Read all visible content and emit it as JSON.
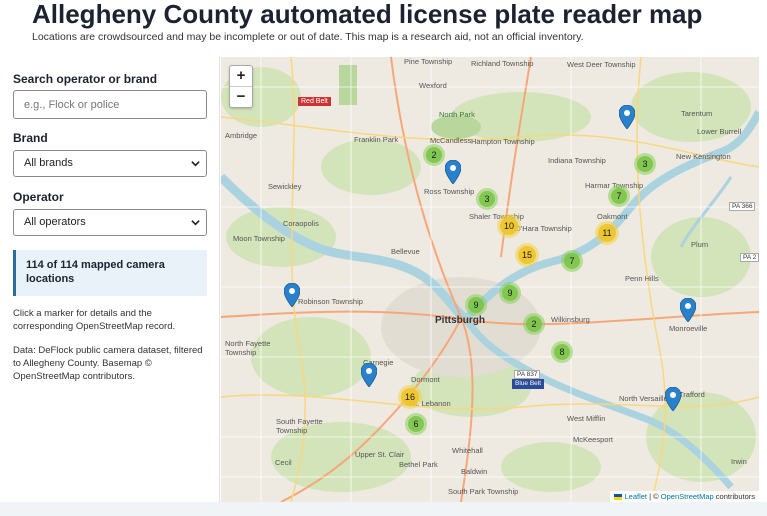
{
  "header": {
    "title": "Allegheny County automated license plate reader map",
    "subtitle": "Locations are crowdsourced and may be incomplete or out of date. This map is a research aid, not an official inventory."
  },
  "sidebar": {
    "search_label": "Search operator or brand",
    "search_placeholder": "e.g., Flock or police",
    "search_value": "",
    "brand_label": "Brand",
    "brand_selected": "All brands",
    "operator_label": "Operator",
    "operator_selected": "All operators",
    "count_text": "114 of 114 mapped camera locations",
    "help_text": "Click a marker for details and the corresponding OpenStreetMap record.",
    "source_text": "Data: DeFlock public camera dataset, filtered to Allegheny County. Basemap © OpenStreetMap contributors."
  },
  "map": {
    "zoom_in": "+",
    "zoom_out": "−",
    "attribution_leaflet": "Leaflet",
    "attribution_sep": " | © ",
    "attribution_osm": "OpenStreetMap",
    "attribution_tail": " contributors",
    "colors": {
      "small_cluster": "#78c346",
      "medium_cluster": "#eec428",
      "pin": "#2a81cb",
      "river": "#aad3df"
    },
    "clusters": [
      {
        "count": "2",
        "size": "small"
      },
      {
        "count": "3",
        "size": "small"
      },
      {
        "count": "3",
        "size": "small"
      },
      {
        "count": "7",
        "size": "small"
      },
      {
        "count": "10",
        "size": "medium"
      },
      {
        "count": "11",
        "size": "medium"
      },
      {
        "count": "15",
        "size": "medium"
      },
      {
        "count": "7",
        "size": "small"
      },
      {
        "count": "9",
        "size": "small"
      },
      {
        "count": "9",
        "size": "small"
      },
      {
        "count": "2",
        "size": "small"
      },
      {
        "count": "8",
        "size": "small"
      },
      {
        "count": "16",
        "size": "medium"
      },
      {
        "count": "6",
        "size": "small"
      }
    ],
    "places": [
      "Pine Township",
      "Richland Township",
      "West Deer Township",
      "Wexford",
      "Red Belt",
      "North Park",
      "Tarentum",
      "Ambridge",
      "Franklin Park",
      "McCandless",
      "Hampton Township",
      "Lower Burrell",
      "New Kensington",
      "Indiana Township",
      "Sewickley",
      "Ross Township",
      "Harmar Township",
      "Coraopolis",
      "Shaler Township",
      "O'Hara Township",
      "Oakmont",
      "PA 366",
      "Moon Township",
      "Bellevue",
      "Plum",
      "Penn Hills",
      "Robinson Township",
      "Pittsburgh",
      "Wilkinsburg",
      "Monroeville",
      "North Fayette Township",
      "Carnegie",
      "Dormont",
      "PA 837",
      "Blue Belt",
      "North Versailles",
      "Trafford",
      "South Fayette Township",
      "Mt. Lebanon",
      "West Mifflin",
      "McKeesport",
      "Whitehall",
      "Upper St. Clair",
      "Baldwin",
      "Bethel Park",
      "Cecil",
      "South Park Township",
      "Irwin",
      "PA 2"
    ]
  }
}
